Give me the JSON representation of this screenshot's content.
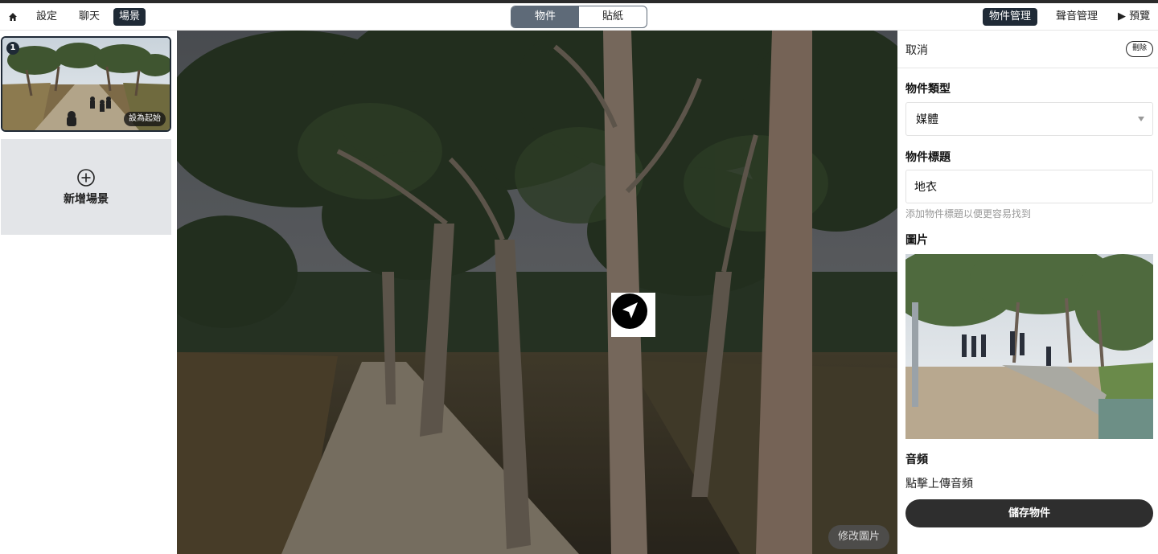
{
  "topbar": {
    "home_icon": "home-icon",
    "nav": [
      {
        "label": "設定",
        "active": false
      },
      {
        "label": "聊天",
        "active": false
      },
      {
        "label": "場景",
        "active": true
      }
    ],
    "segmented": [
      {
        "label": "物件",
        "active": true
      },
      {
        "label": "貼紙",
        "active": false
      }
    ],
    "right_nav": [
      {
        "label": "物件管理",
        "active": true
      },
      {
        "label": "聲音管理",
        "active": false
      },
      {
        "label": "▶ 預覽",
        "active": false
      }
    ]
  },
  "scenes": {
    "items": [
      {
        "index": "1",
        "set_start_label": "設為起始"
      }
    ],
    "add_label": "新增場景",
    "add_icon": "plus-circle-icon"
  },
  "viewer": {
    "hotspot_icon": "navigation-arrow-icon",
    "edit_image_label": "修改圖片"
  },
  "editor": {
    "cancel_label": "取消",
    "delete_label": "刪除",
    "type_label": "物件類型",
    "type_value": "媒體",
    "title_label": "物件標題",
    "title_value": "地衣",
    "title_hint": "添加物件標題以便更容易找到",
    "image_label": "圖片",
    "audio_label": "音頻",
    "audio_upload_label": "點擊上傳音頻",
    "save_label": "儲存物件"
  },
  "colors": {
    "dark": "#1f2a36",
    "segment_active": "#5e6a78",
    "save_button": "#2e2e2e"
  }
}
